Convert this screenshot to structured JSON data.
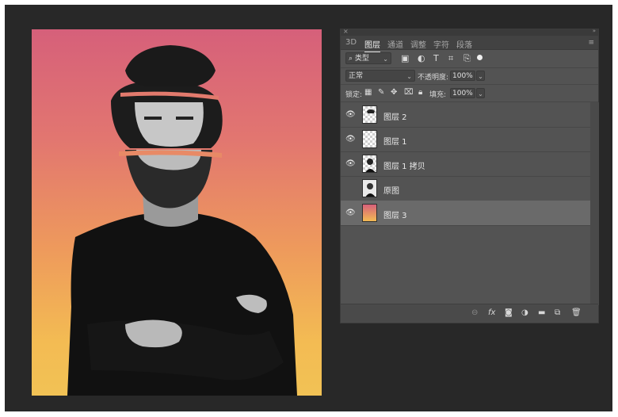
{
  "panel": {
    "tabs": [
      {
        "label": "3D",
        "active": false
      },
      {
        "label": "图层",
        "active": true
      },
      {
        "label": "通道",
        "active": false
      },
      {
        "label": "调整",
        "active": false
      },
      {
        "label": "字符",
        "active": false
      },
      {
        "label": "段落",
        "active": false
      }
    ],
    "filter_kind": "类型",
    "blend_mode": "正常",
    "opacity_label": "不透明度:",
    "opacity_value": "100%",
    "lock_label": "锁定:",
    "fill_label": "填充:",
    "fill_value": "100%",
    "layers": [
      {
        "name": "图层 2",
        "visible": true,
        "thumb": "checker",
        "selected": false
      },
      {
        "name": "图层 1",
        "visible": true,
        "thumb": "checker",
        "selected": false
      },
      {
        "name": "图层 1 拷贝",
        "visible": true,
        "thumb": "portrait",
        "selected": false
      },
      {
        "name": "原图",
        "visible": false,
        "thumb": "photo",
        "selected": false
      },
      {
        "name": "图层 3",
        "visible": true,
        "thumb": "gradient",
        "selected": true
      }
    ],
    "bottom_icons": [
      "link-icon",
      "fx-icon",
      "mask-icon",
      "adjustment-icon",
      "folder-icon",
      "new-layer-icon",
      "trash-icon"
    ]
  },
  "colors": {
    "gradient_top": "#d6607a",
    "gradient_bottom": "#f3bb53",
    "panel_bg": "#535353",
    "app_bg": "#282828"
  }
}
